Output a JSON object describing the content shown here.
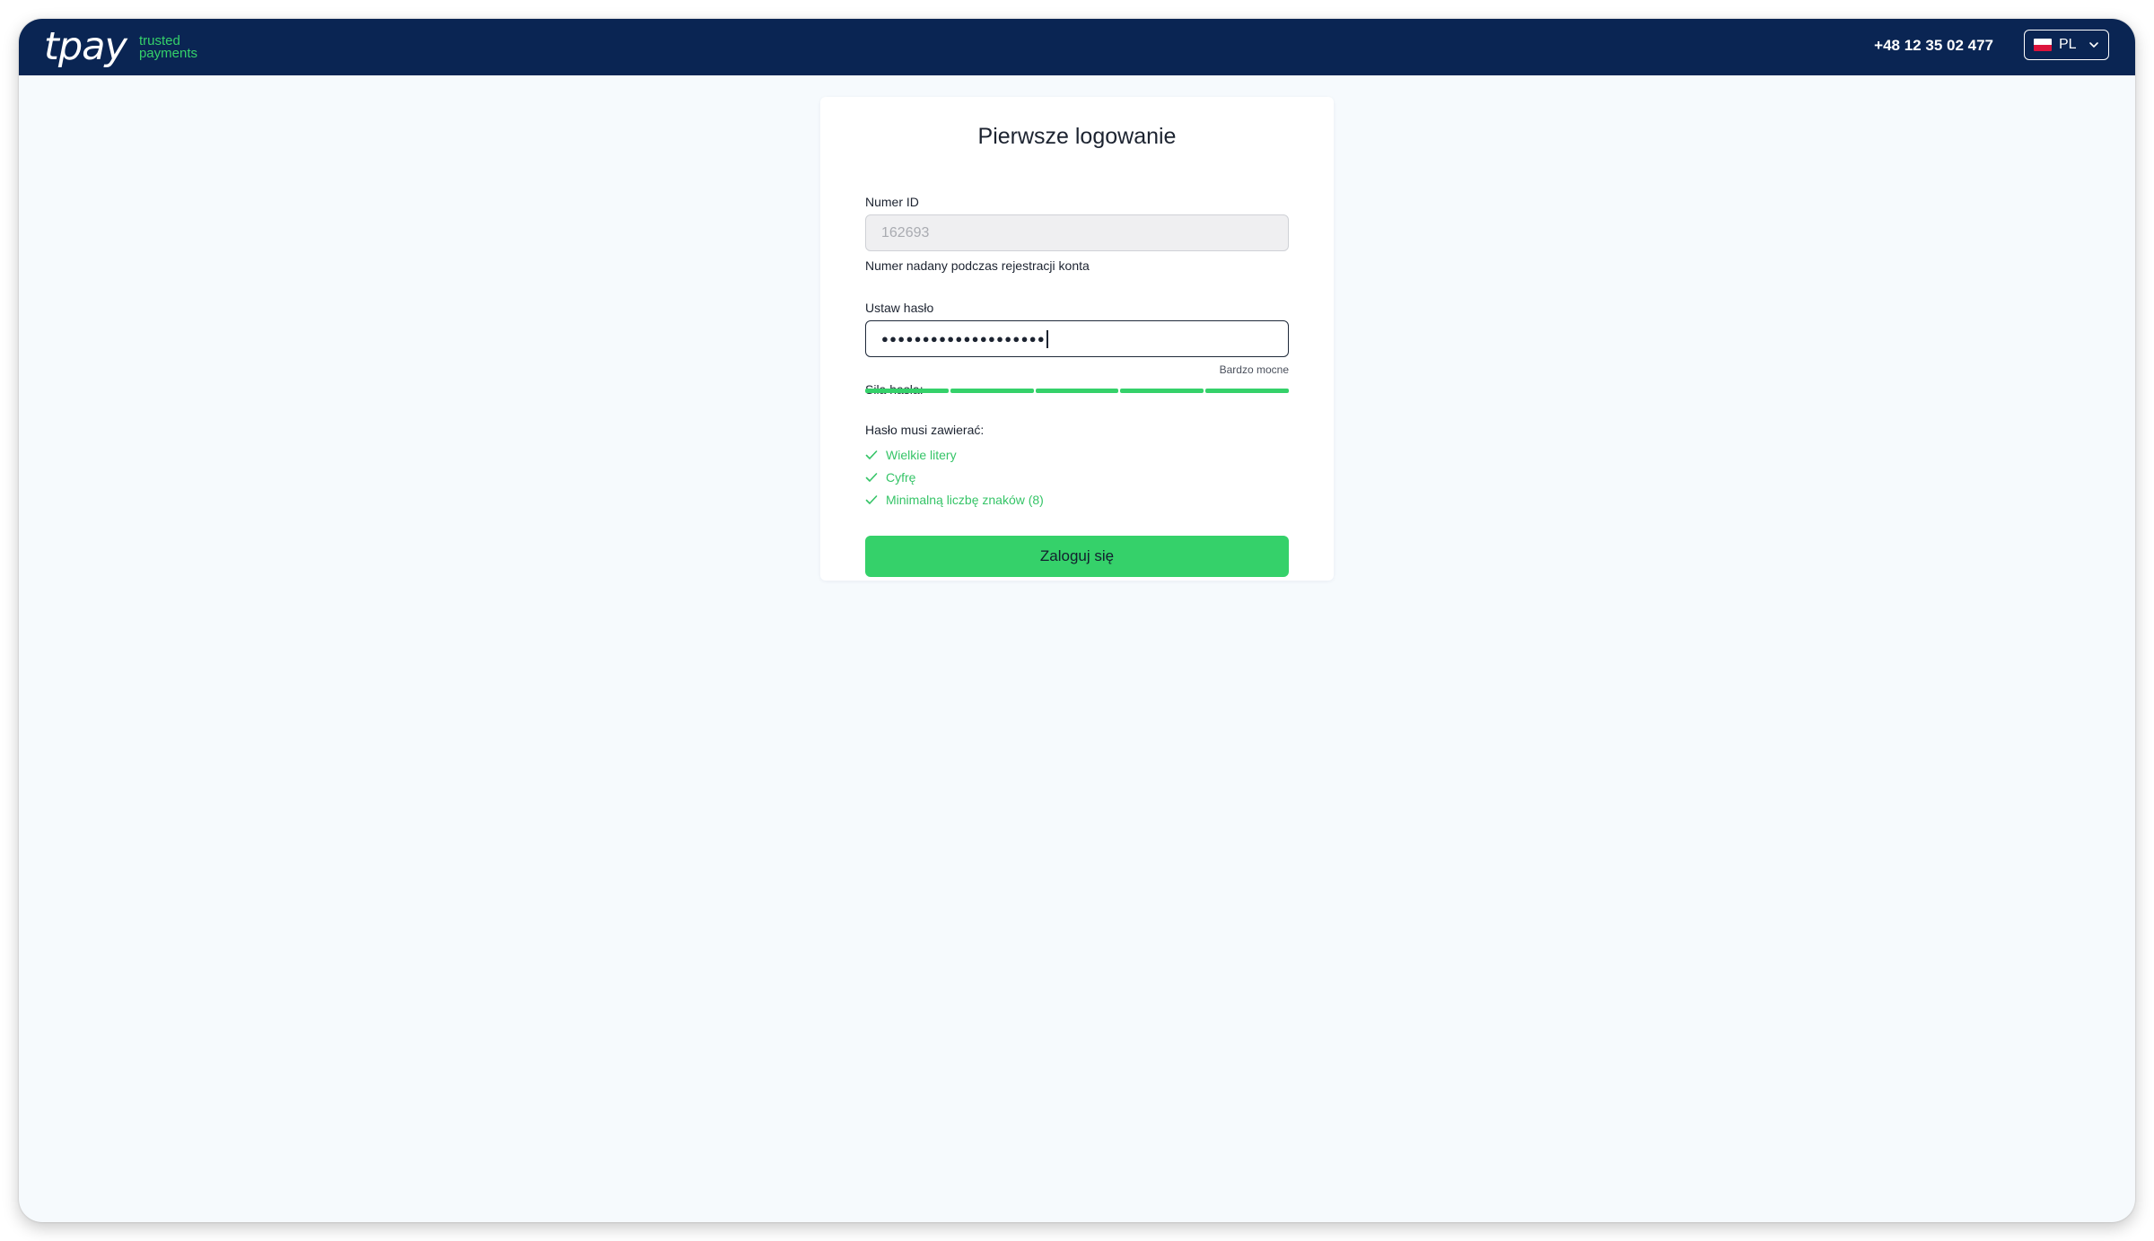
{
  "header": {
    "logo_text": "tpay",
    "tagline_line1": "trusted",
    "tagline_line2": "payments",
    "phone": "+48 12 35 02 477",
    "language": "PL",
    "colors": {
      "background": "#0a2553",
      "accent": "#35d16a"
    }
  },
  "form": {
    "title": "Pierwsze logowanie",
    "id_label": "Numer ID",
    "id_value": "162693",
    "id_hint": "Numer nadany podczas rejestracji konta",
    "password_label": "Ustaw hasło",
    "password_mask": "●●●●●●●●●●●●●●●●●●●●",
    "strength_label": "Siła hasła:",
    "strength_value": "Bardzo mocne",
    "strength_level": 5,
    "strength_max": 5,
    "requirements_title": "Hasło musi zawierać:",
    "requirements": [
      {
        "text": "Wielkie litery",
        "met": true
      },
      {
        "text": "Cyfrę",
        "met": true
      },
      {
        "text": "Minimalną liczbę znaków (8)",
        "met": true
      }
    ],
    "submit_label": "Zaloguj się"
  }
}
